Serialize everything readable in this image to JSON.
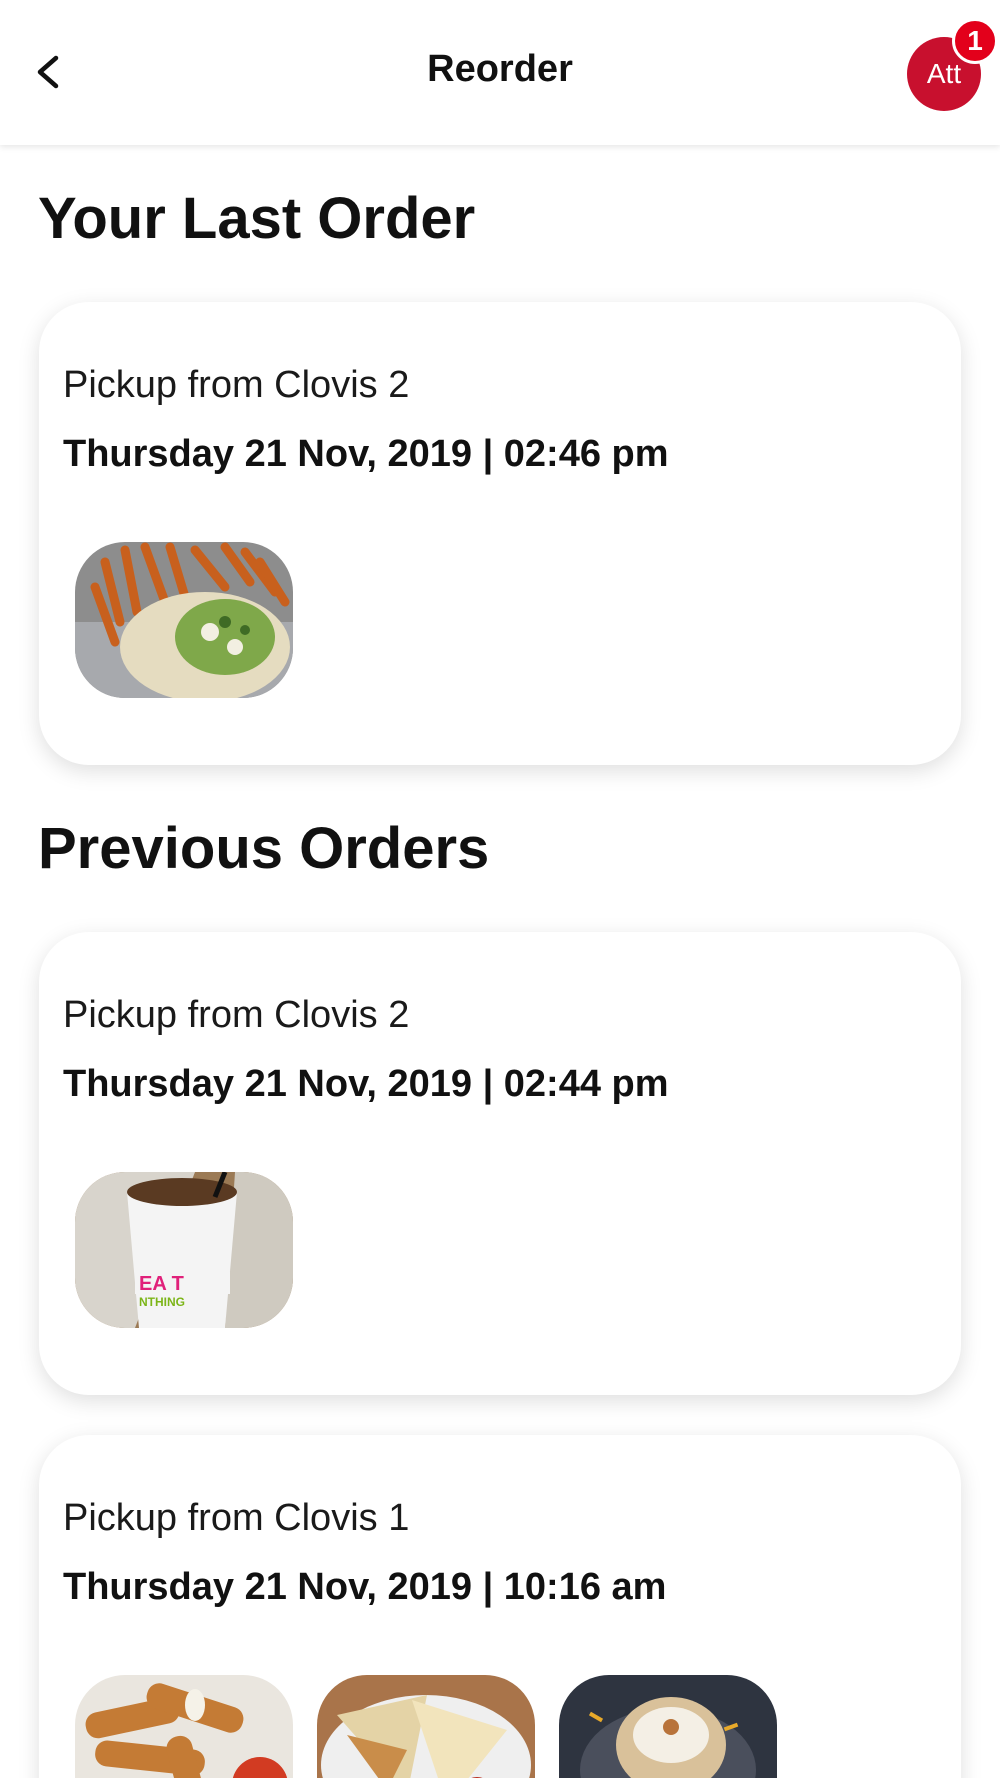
{
  "header": {
    "title": "Reorder",
    "back_icon": "chevron-left-icon",
    "avatar_label": "Att",
    "avatar_color": "#c8102e",
    "notification_count": "1"
  },
  "sections": {
    "last_order_title": "Your Last Order",
    "previous_orders_title": "Previous Orders"
  },
  "last_order": {
    "pickup": "Pickup from Clovis 2",
    "datetime": "Thursday 21 Nov, 2019 | 02:46 pm",
    "items": [
      "wrap-and-fries-photo"
    ]
  },
  "previous_orders": [
    {
      "pickup": "Pickup from Clovis 2",
      "datetime": "Thursday 21 Nov, 2019 | 02:44 pm",
      "items": [
        "iced-tea-cup-photo"
      ]
    },
    {
      "pickup": "Pickup from Clovis 1",
      "datetime": "Thursday 21 Nov, 2019 | 10:16 am",
      "items": [
        "mozzarella-sticks-photo",
        "quesadilla-photo",
        "loaded-baked-potato-photo"
      ]
    }
  ]
}
